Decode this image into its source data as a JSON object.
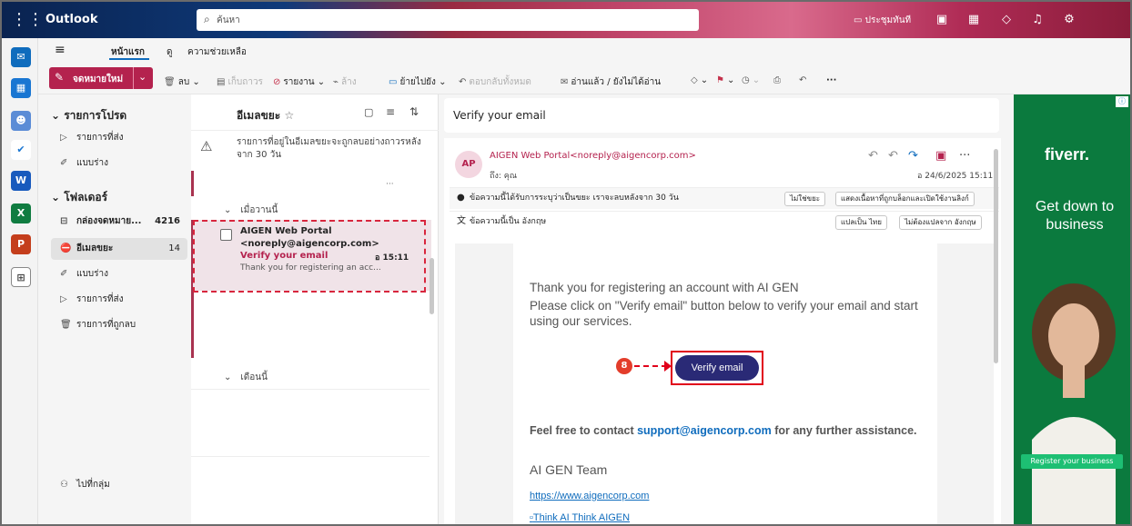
{
  "app": {
    "name": "Outlook"
  },
  "search": {
    "placeholder": "ค้นหา"
  },
  "topbar": {
    "meet_now": "ประชุมทันที"
  },
  "ribbon_tabs": [
    "หน้าแรก",
    "ดู",
    "ความช่วยเหลือ"
  ],
  "ribbon": {
    "new_mail": "จดหมายใหม่",
    "delete": "ลบ",
    "archive": "เก็บถาวร",
    "report": "รายงาน",
    "sweep": "ล้าง",
    "move_to": "ย้ายไปยัง",
    "reply_all": "ตอบกลับทั้งหมด",
    "read_unread": "อ่านแล้ว / ยังไม่ได้อ่าน"
  },
  "folders": {
    "favorites_title": "รายการโปรด",
    "favorites": [
      {
        "label": "รายการที่ส่ง",
        "icon": "send-icon"
      },
      {
        "label": "แบบร่าง",
        "icon": "draft-icon"
      }
    ],
    "folders_title": "โฟลเดอร์",
    "items": [
      {
        "label": "กล่องจดหมาย...",
        "count": "4216",
        "icon": "inbox-icon"
      },
      {
        "label": "อีเมลขยะ",
        "count": "14",
        "icon": "junk-icon"
      },
      {
        "label": "แบบร่าง",
        "count": "",
        "icon": "draft-icon"
      },
      {
        "label": "รายการที่ส่ง",
        "count": "",
        "icon": "send-icon"
      },
      {
        "label": "รายการที่ถูกลบ",
        "count": "",
        "icon": "trash-icon"
      }
    ],
    "go_to_groups": "ไปที่กลุ่ม"
  },
  "list": {
    "title": "อีเมลขยะ",
    "notice": "รายการที่อยู่ในอีเมลขยะจะถูกลบอย่างถาวรหลังจาก 30 วัน",
    "group_yesterday": "เมื่อวานนี้",
    "group_this_month": "เดือนนี้",
    "message": {
      "from_line1": "AIGEN Web Portal",
      "from_line2": "<noreply@aigencorp.com>",
      "subject": "Verify your email",
      "time": "อ 15:11",
      "preview": "Thank you for registering an acc..."
    }
  },
  "reader": {
    "subject": "Verify your email",
    "avatar": "AP",
    "sender": "AIGEN Web Portal<noreply@aigencorp.com>",
    "to": "ถึง: คุณ",
    "date": "อ 24/6/2025 15:11",
    "junk_notice": "ข้อความนี้ได้รับการระบุว่าเป็นขยะ เราจะลบหลังจาก 30 วัน",
    "not_junk": "ไม่ใช่ขยะ",
    "show_blocked": "แสดงเนื้อหาที่ถูกบล็อกและเปิดใช้งานลิงก์",
    "lang_notice": "ข้อความนี้เป็น อังกฤษ",
    "translate": "แปลเป็น ไทย",
    "dont_translate": "ไม่ต้องแปลจาก อังกฤษ",
    "body": {
      "line1": "Thank you for registering an account with AI GEN",
      "line2": "Please click on \"Verify email\" button below to verify your email and start using our services.",
      "verify_button": "Verify email",
      "step_number": "8",
      "contact_pre": "Feel free to contact ",
      "contact_email": "support@aigencorp.com",
      "contact_post": " for any further assistance.",
      "team": "AI GEN Team",
      "site": "https://www.aigencorp.com",
      "image_alt": "Think AI Think AIGEN"
    }
  },
  "ad": {
    "logo": "fiverr.",
    "tagline": "Get down to business",
    "cta": "Register your business"
  },
  "colors": {
    "accent": "#b4224e",
    "button": "#2a2a76",
    "highlight": "#e1001a",
    "ad_bg": "#0b7a3e"
  }
}
